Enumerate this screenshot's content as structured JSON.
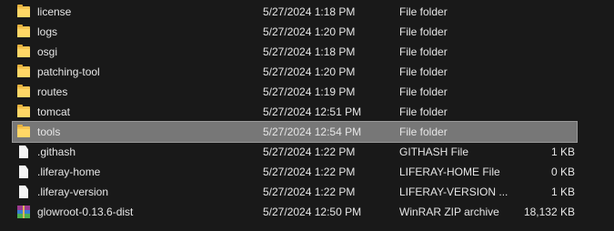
{
  "files": [
    {
      "name": "license",
      "date": "5/27/2024 1:18 PM",
      "type": "File folder",
      "size": "",
      "icon": "folder-icon"
    },
    {
      "name": "logs",
      "date": "5/27/2024 1:20 PM",
      "type": "File folder",
      "size": "",
      "icon": "folder-icon"
    },
    {
      "name": "osgi",
      "date": "5/27/2024 1:18 PM",
      "type": "File folder",
      "size": "",
      "icon": "folder-icon"
    },
    {
      "name": "patching-tool",
      "date": "5/27/2024 1:20 PM",
      "type": "File folder",
      "size": "",
      "icon": "folder-icon"
    },
    {
      "name": "routes",
      "date": "5/27/2024 1:19 PM",
      "type": "File folder",
      "size": "",
      "icon": "folder-icon"
    },
    {
      "name": "tomcat",
      "date": "5/27/2024 12:51 PM",
      "type": "File folder",
      "size": "",
      "icon": "folder-icon"
    },
    {
      "name": "tools",
      "date": "5/27/2024 12:54 PM",
      "type": "File folder",
      "size": "",
      "icon": "folder-icon",
      "selected": true
    },
    {
      "name": ".githash",
      "date": "5/27/2024 1:22 PM",
      "type": "GITHASH File",
      "size": "1 KB",
      "icon": "file-icon"
    },
    {
      "name": ".liferay-home",
      "date": "5/27/2024 1:22 PM",
      "type": "LIFERAY-HOME File",
      "size": "0 KB",
      "icon": "file-icon"
    },
    {
      "name": ".liferay-version",
      "date": "5/27/2024 1:22 PM",
      "type": "LIFERAY-VERSION ...",
      "size": "1 KB",
      "icon": "file-icon"
    },
    {
      "name": "glowroot-0.13.6-dist",
      "date": "5/27/2024 12:50 PM",
      "type": "WinRAR ZIP archive",
      "size": "18,132 KB",
      "icon": "archive-icon"
    }
  ],
  "colors": {
    "background": "#191919",
    "selected": "#777777",
    "text": "#e6e6e6",
    "folder": "#f5c553"
  }
}
